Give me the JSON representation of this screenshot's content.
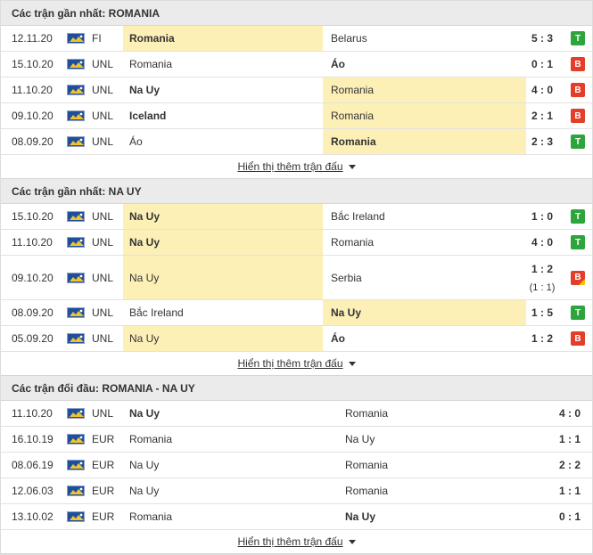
{
  "sections": [
    {
      "title": "Các trận gần nhất: ROMANIA",
      "more_label": "Hiển thị thêm trận đấu",
      "matches": [
        {
          "date": "12.11.20",
          "comp": "FI",
          "home": "Romania",
          "away": "Belarus",
          "score": "5 : 3",
          "result": "T"
        },
        {
          "date": "15.10.20",
          "comp": "UNL",
          "home": "Romania",
          "away": "Áo",
          "score": "0 : 1",
          "result": "B"
        },
        {
          "date": "11.10.20",
          "comp": "UNL",
          "home": "Na Uy",
          "away": "Romania",
          "score": "4 : 0",
          "result": "B"
        },
        {
          "date": "09.10.20",
          "comp": "UNL",
          "home": "Iceland",
          "away": "Romania",
          "score": "2 : 1",
          "result": "B"
        },
        {
          "date": "08.09.20",
          "comp": "UNL",
          "home": "Áo",
          "away": "Romania",
          "score": "2 : 3",
          "result": "T"
        }
      ]
    },
    {
      "title": "Các trận gần nhất: NA UY",
      "more_label": "Hiển thị thêm trận đấu",
      "matches": [
        {
          "date": "15.10.20",
          "comp": "UNL",
          "home": "Na Uy",
          "away": "Bắc Ireland",
          "score": "1 : 0",
          "result": "T"
        },
        {
          "date": "11.10.20",
          "comp": "UNL",
          "home": "Na Uy",
          "away": "Romania",
          "score": "4 : 0",
          "result": "T"
        },
        {
          "date": "09.10.20",
          "comp": "UNL",
          "home": "Na Uy",
          "away": "Serbia",
          "score": "1 : 2",
          "score_sub": "(1 : 1)",
          "result": "B"
        },
        {
          "date": "08.09.20",
          "comp": "UNL",
          "home": "Bắc Ireland",
          "away": "Na Uy",
          "score": "1 : 5",
          "result": "T"
        },
        {
          "date": "05.09.20",
          "comp": "UNL",
          "home": "Na Uy",
          "away": "Áo",
          "score": "1 : 2",
          "result": "B"
        }
      ]
    },
    {
      "title": "Các trận đối đầu: ROMANIA - NA UY",
      "more_label": "Hiển thị thêm trận đấu",
      "matches": [
        {
          "date": "11.10.20",
          "comp": "UNL",
          "home": "Na Uy",
          "away": "Romania",
          "score": "4 : 0"
        },
        {
          "date": "16.10.19",
          "comp": "EUR",
          "home": "Romania",
          "away": "Na Uy",
          "score": "1 : 1"
        },
        {
          "date": "08.06.19",
          "comp": "EUR",
          "home": "Na Uy",
          "away": "Romania",
          "score": "2 : 2"
        },
        {
          "date": "12.06.03",
          "comp": "EUR",
          "home": "Na Uy",
          "away": "Romania",
          "score": "1 : 1"
        },
        {
          "date": "13.10.02",
          "comp": "EUR",
          "home": "Romania",
          "away": "Na Uy",
          "score": "0 : 1"
        }
      ]
    }
  ],
  "colors": {
    "win": "#2ea53c",
    "loss": "#e23e2a",
    "highlight": "#fdf0b7",
    "header_bg": "#ebebeb"
  }
}
